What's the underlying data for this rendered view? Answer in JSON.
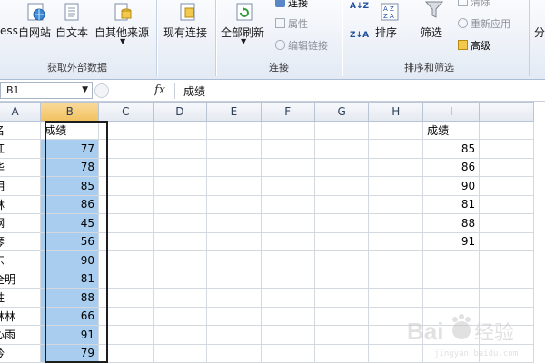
{
  "ribbon": {
    "from_access_label": "ess",
    "from_web_label": "自网站",
    "from_text_label": "自文本",
    "from_other_label": "自其他来源",
    "existing_conn_label": "现有连接",
    "refresh_all_label": "全部刷新",
    "connections_label": "连接",
    "properties_label": "属性",
    "edit_links_label": "编辑链接",
    "sort_az_label": "A↓Z",
    "sort_za_label": "Z↓A",
    "sort_label": "排序",
    "filter_label": "筛选",
    "clear_label": "清除",
    "reapply_label": "重新应用",
    "advanced_label": "高级",
    "split_label": "分",
    "group_external": "获取外部数据",
    "group_connections": "连接",
    "group_sort_filter": "排序和筛选"
  },
  "formula_bar": {
    "name_box": "B1",
    "fx": "fx",
    "content": "成绩"
  },
  "sheet": {
    "columns": [
      "A",
      "B",
      "C",
      "D",
      "E",
      "F",
      "G",
      "H",
      "I"
    ],
    "rows": [
      {
        "a": "名",
        "b": "成绩",
        "i": "成绩"
      },
      {
        "a": "红",
        "b": "77",
        "i": "85"
      },
      {
        "a": "华",
        "b": "78",
        "i": "86"
      },
      {
        "a": "明",
        "b": "85",
        "i": "90"
      },
      {
        "a": "林",
        "b": "86",
        "i": "81"
      },
      {
        "a": "钢",
        "b": "45",
        "i": "88"
      },
      {
        "a": "琴",
        "b": "56",
        "i": "91"
      },
      {
        "a": "东",
        "b": "90",
        "i": ""
      },
      {
        "a": "全明",
        "b": "81",
        "i": ""
      },
      {
        "a": "胜",
        "b": "88",
        "i": ""
      },
      {
        "a": "林林",
        "b": "66",
        "i": ""
      },
      {
        "a": "心雨",
        "b": "91",
        "i": ""
      },
      {
        "a": "玲",
        "b": "79",
        "i": ""
      }
    ]
  },
  "colors": {
    "selection_fill": "#a9cdee",
    "selected_header": "#f1c15f",
    "ribbon_bg": "#e3eaf4"
  }
}
